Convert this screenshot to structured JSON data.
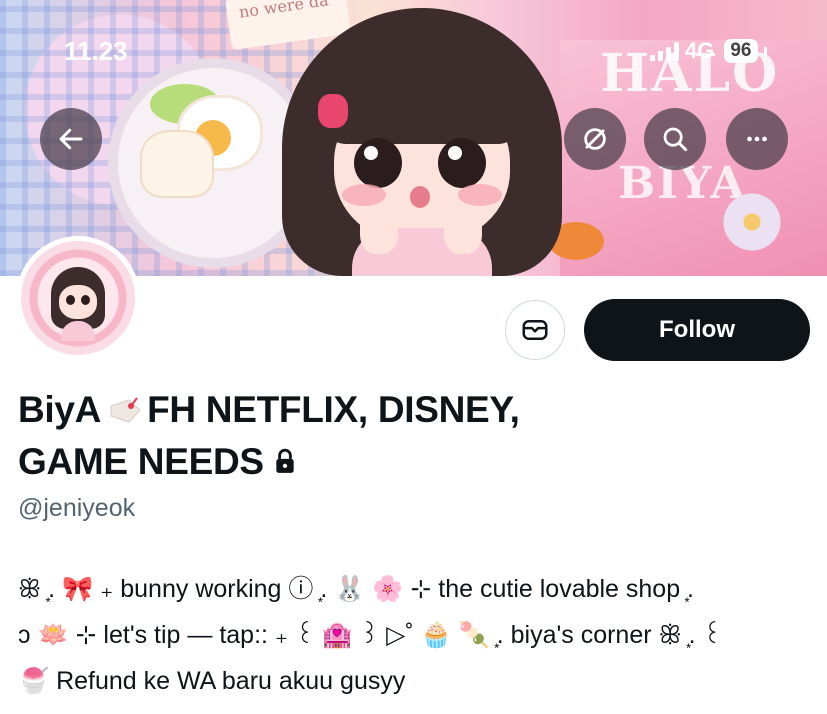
{
  "status_bar": {
    "time": "11.23",
    "network": "4G",
    "battery": "96"
  },
  "banner": {
    "note_text": "no\nwere da",
    "title_top": "HALO",
    "title_bottom": "BIYA"
  },
  "header_actions": {
    "back_icon": "arrow-left-icon",
    "mute_icon": "mute-circle-icon",
    "search_icon": "search-icon",
    "more_icon": "more-horizontal-icon"
  },
  "profile": {
    "message_icon": "envelope-icon",
    "follow_label": "Follow",
    "name_part1": "BiyA",
    "name_part2": "FH NETFLIX, DISNEY,",
    "name_part3": "GAME NEEDS",
    "handle": "@jeniyeok",
    "protected": true
  },
  "bio": {
    "line1": "ꕥ ͙. 🎀 ₊ bunny working ⓘ ͙. 🐰 🌸 ⊹ the cutie lovable shop ͙.",
    "line2": "ↄ 🪷 ⊹ let's tip — tap:: ₊ ꒰ 🏩 ꒱ ▷˚ 🧁 🍡 ͙. biya's corner ꕥ ͙. ꒰",
    "line3": "🍧 Refund ke WA baru akuu gusyy"
  },
  "colors": {
    "follow_bg": "#0f1419",
    "text_primary": "#0f1419",
    "text_secondary": "#536471",
    "border": "#cfd9de"
  }
}
